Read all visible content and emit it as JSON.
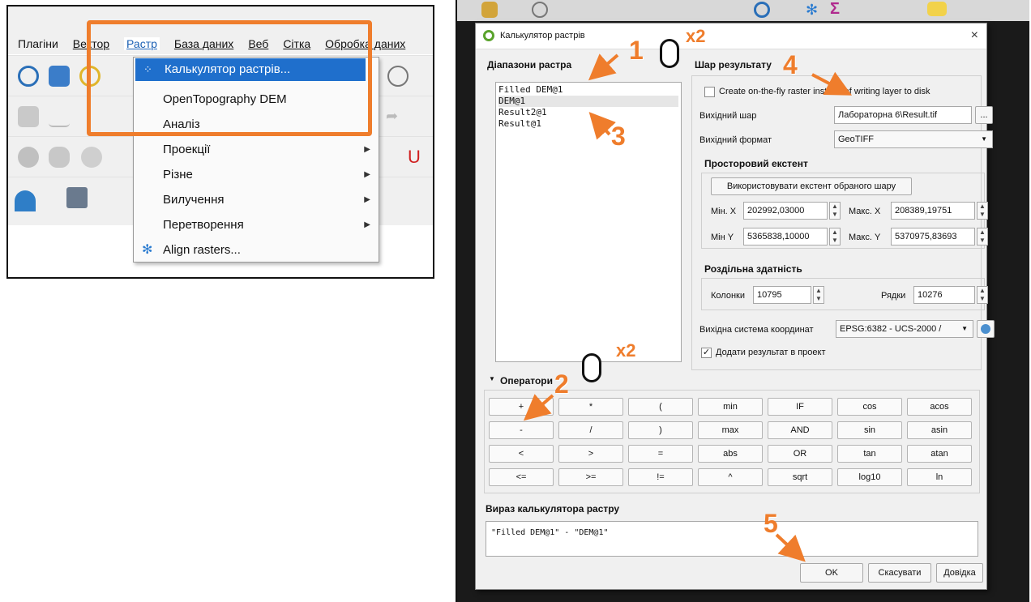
{
  "left_menu": {
    "menubar": [
      "Плагіни",
      "Вектор",
      "Растр",
      "База даних",
      "Веб",
      "Сітка",
      "Обробка даних"
    ],
    "active_menu": "Растр",
    "dropdown_items": [
      {
        "label": "Калькулятор растрів...",
        "has_submenu": false,
        "icon": "calculator-icon"
      },
      {
        "label": "OpenTopography DEM",
        "has_submenu": false,
        "icon": ""
      },
      {
        "label": "Аналіз",
        "has_submenu": true,
        "icon": ""
      },
      {
        "label": "Проекції",
        "has_submenu": true,
        "icon": ""
      },
      {
        "label": "Різне",
        "has_submenu": true,
        "icon": ""
      },
      {
        "label": "Вилучення",
        "has_submenu": true,
        "icon": ""
      },
      {
        "label": "Перетворення",
        "has_submenu": true,
        "icon": ""
      },
      {
        "label": "Align rasters...",
        "has_submenu": false,
        "icon": "align-rasters-icon"
      }
    ]
  },
  "dialog": {
    "title": "Калькулятор растрів",
    "close_glyph": "×",
    "raster_bands_title": "Діапазони растра",
    "raster_bands": [
      "Filled DEM@1",
      "DEM@1",
      "Result2@1",
      "Result@1"
    ],
    "result_layer_title": "Шар результату",
    "on_the_fly_label": "Create on-the-fly raster instead of writing layer to disk",
    "output_layer_label": "Вихідний шар",
    "output_layer_value": "Лабораторна 6\\Result.tif",
    "browse_label": "...",
    "output_format_label": "Вихідний формат",
    "output_format_value": "GeoTIFF",
    "spatial_extent_title": "Просторовий екстент",
    "use_extent_button": "Використовувати екстент обраного шару",
    "min_x_label": "Мін. X",
    "min_x_value": "202992,03000",
    "max_x_label": "Макс. X",
    "max_x_value": "208389,19751",
    "min_y_label": "Мін Y",
    "min_y_value": "5365838,10000",
    "max_y_label": "Макс. Y",
    "max_y_value": "5370975,83693",
    "resolution_title": "Роздільна здатність",
    "columns_label": "Колонки",
    "columns_value": "10795",
    "rows_label": "Рядки",
    "rows_value": "10276",
    "crs_label": "Вихідна система координат",
    "crs_value": "EPSG:6382 - UCS-2000 /",
    "add_to_project_label": "Додати результат в проект",
    "add_to_project_checked": true,
    "operators_title": "Оператори",
    "operators": [
      [
        "+",
        "*",
        "(",
        "min",
        "IF",
        "cos",
        "acos"
      ],
      [
        "-",
        "/",
        ")",
        "max",
        "AND",
        "sin",
        "asin"
      ],
      [
        "<",
        ">",
        "=",
        "abs",
        "OR",
        "tan",
        "atan"
      ],
      [
        "<=",
        ">=",
        "!=",
        "^",
        "sqrt",
        "log10",
        "ln"
      ]
    ],
    "expression_title": "Вираз калькулятора растру",
    "expression_value": "\"Filled DEM@1\"  - \"DEM@1\"",
    "ok_button": "OK",
    "cancel_button": "Скасувати",
    "help_button": "Довідка"
  },
  "annotations": {
    "steps": [
      "1",
      "2",
      "3",
      "4",
      "5"
    ],
    "double_click_labels": [
      "x2",
      "x2"
    ],
    "accent_color": "#ef7d2c"
  }
}
